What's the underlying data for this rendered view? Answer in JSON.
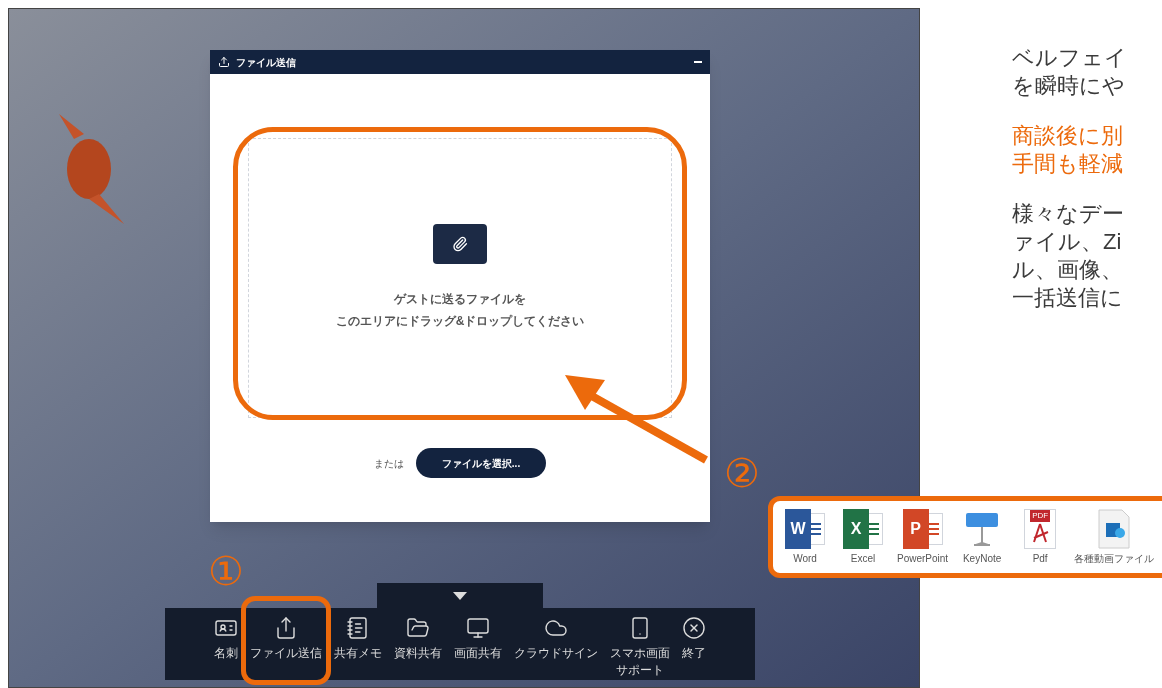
{
  "screenshot": {
    "dialog": {
      "title": "ファイル送信",
      "drop_hint": [
        "ゲストに送るファイルを",
        "このエリアにドラッグ&ドロップしてください"
      ],
      "or_label": "または",
      "select_button": "ファイルを選択..."
    },
    "toolbar": [
      {
        "kind": "card",
        "label": [
          "名刺"
        ]
      },
      {
        "kind": "upload",
        "label": [
          "ファイル送信"
        ]
      },
      {
        "kind": "memo",
        "label": [
          "共有メモ"
        ]
      },
      {
        "kind": "folder",
        "label": [
          "資料共有"
        ]
      },
      {
        "kind": "screen",
        "label": [
          "画面共有"
        ]
      },
      {
        "kind": "cloud",
        "label": [
          "クラウドサイン"
        ]
      },
      {
        "kind": "phone",
        "label": [
          "スマホ画面",
          "サポート"
        ]
      },
      {
        "kind": "close",
        "label": [
          "終了"
        ]
      }
    ]
  },
  "markers": [
    "①",
    "②"
  ],
  "description": [
    {
      "kind": "normal",
      "lines": [
        "ベルフェイ",
        "を瞬時にや"
      ]
    },
    {
      "kind": "highlight",
      "lines": [
        "商談後に別",
        "手間も軽減"
      ]
    },
    {
      "kind": "normal",
      "lines": [
        "様々なデー",
        "ァイル、Zi",
        "ル、画像、",
        "一括送信に"
      ]
    }
  ],
  "file_types": [
    {
      "kind": "word",
      "letter": "W",
      "label": "Word"
    },
    {
      "kind": "excel",
      "letter": "X",
      "label": "Excel"
    },
    {
      "kind": "powerpoint",
      "letter": "P",
      "label": "PowerPoint"
    },
    {
      "kind": "keynote",
      "label": "KeyNote"
    },
    {
      "kind": "pdf",
      "letter": "PDF",
      "label": "Pdf"
    },
    {
      "kind": "video",
      "label": "各種動画ファイル"
    }
  ]
}
